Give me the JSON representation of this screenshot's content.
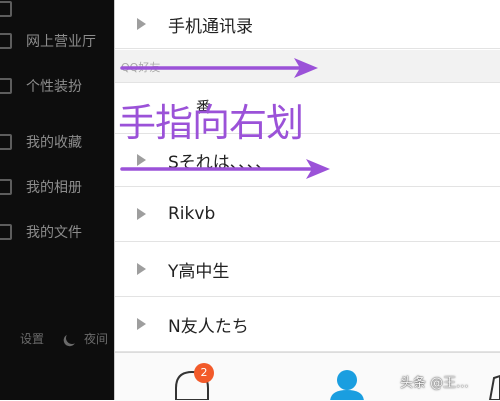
{
  "drawer": {
    "items": [
      {
        "label": "网上营业厅",
        "icon": "store-icon"
      },
      {
        "label": "个性装扮",
        "icon": "shirt-icon"
      },
      {
        "label": "我的收藏",
        "icon": "star-icon"
      },
      {
        "label": "我的相册",
        "icon": "photo-icon"
      },
      {
        "label": "我的文件",
        "icon": "folder-icon"
      }
    ],
    "settings_label": "设置",
    "night_label": "夜间"
  },
  "contacts": {
    "top_group": "手机通讯录",
    "section_header": "QQ好友",
    "partial_group": "番",
    "groups": [
      "Sそれは、、、、",
      "Rikvb",
      "Y高中生",
      "N友人たち"
    ]
  },
  "tabbar": {
    "messages_badge": "2"
  },
  "annotation": {
    "text": "手指向右划",
    "color": "#9b52d8"
  },
  "watermark": "头条 @王..."
}
